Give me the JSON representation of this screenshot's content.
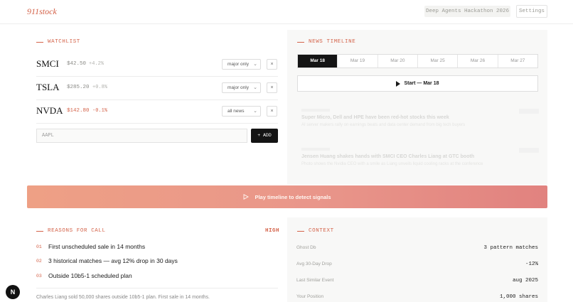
{
  "header": {
    "logo": "911stock",
    "badge": "Deep Agents Hackathon 2026",
    "settings_label": "Settings"
  },
  "watchlist": {
    "title": "WATCHLIST",
    "rows": [
      {
        "ticker": "SMCI",
        "price": "$42.50",
        "change": "+4.2%",
        "filter": "major only",
        "negative": false
      },
      {
        "ticker": "TSLA",
        "price": "$285.20",
        "change": "+0.8%",
        "filter": "major only",
        "negative": false
      },
      {
        "ticker": "NVDA",
        "price": "$142.80",
        "change": "-0.1%",
        "filter": "all news",
        "negative": true
      }
    ],
    "remove_label": "×",
    "input_placeholder": "AAPL",
    "add_label": "+ ADD"
  },
  "news_timeline": {
    "title": "NEWS TIMELINE",
    "dates": [
      "Mar 18",
      "Mar 19",
      "Mar 20",
      "Mar 25",
      "Mar 26",
      "Mar 27"
    ],
    "selected_date": "Mar 18",
    "start_label": "Start — Mar 18",
    "items": [
      {
        "headline": "Super Micro, Dell and HPE have been red-hot stocks this week",
        "sub": "AI server makers rally on earnings beats and data center demand from big tech buyers"
      },
      {
        "headline": "Jensen Huang shakes hands with SMCI CEO Charles Liang at GTC booth",
        "sub": "Photo shows the Nvidia CEO with a smile as Liang unveils liquid cooling racks at the conference"
      }
    ]
  },
  "play_banner": {
    "label": "Play timeline to detect signals"
  },
  "reasons": {
    "title": "REASONS FOR CALL",
    "level": "HIGH",
    "items": [
      {
        "num": "01",
        "text": "First unscheduled sale in 14 months"
      },
      {
        "num": "02",
        "text": "3 historical matches — avg 12% drop in 30 days"
      },
      {
        "num": "03",
        "text": "Outside 10b5-1 scheduled plan"
      }
    ],
    "summary": "Charles Liang sold 50,000 shares outside 10b5-1 plan. First sale in 14 months."
  },
  "context": {
    "title": "CONTEXT",
    "rows": [
      {
        "key": "Ghost Db",
        "value": "3 pattern matches"
      },
      {
        "key": "Avg 30-Day Drop",
        "value": "-12%"
      },
      {
        "key": "Last Similar Event",
        "value": "aug 2025"
      },
      {
        "key": "Your Position",
        "value": "1,000 shares"
      }
    ]
  },
  "avatar": {
    "letter": "N"
  },
  "colors": {
    "accent": "#d4634a",
    "dark": "#141414",
    "banner_start": "#eea085",
    "banner_end": "#e1827f"
  }
}
